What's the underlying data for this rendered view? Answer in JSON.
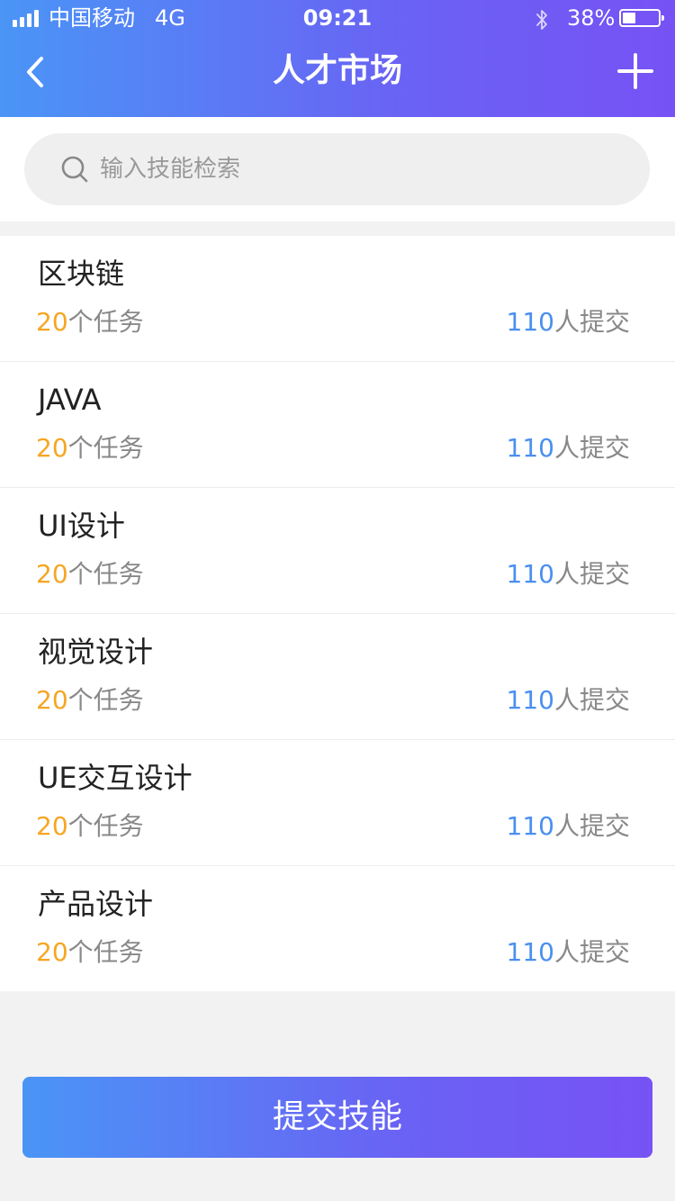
{
  "status_bar": {
    "carrier": "中国移动",
    "network": "4G",
    "time": "09:21",
    "battery_percent": "38%",
    "battery_level": 0.38,
    "icons": [
      "signal-icon",
      "bluetooth-icon",
      "battery-icon"
    ]
  },
  "nav": {
    "title": "人才市场",
    "back_icon": "back-arrow-icon",
    "add_icon": "plus-icon"
  },
  "search": {
    "placeholder": "输入技能检索",
    "value": "",
    "icon": "search-icon"
  },
  "skills": [
    {
      "name": "区块链",
      "task_count": "20",
      "task_suffix": "个任务",
      "submit_count": "110",
      "submit_suffix": "人提交"
    },
    {
      "name": "JAVA",
      "task_count": "20",
      "task_suffix": "个任务",
      "submit_count": "110",
      "submit_suffix": "人提交"
    },
    {
      "name": "UI设计",
      "task_count": "20",
      "task_suffix": "个任务",
      "submit_count": "110",
      "submit_suffix": "人提交"
    },
    {
      "name": "视觉设计",
      "task_count": "20",
      "task_suffix": "个任务",
      "submit_count": "110",
      "submit_suffix": "人提交"
    },
    {
      "name": "UE交互设计",
      "task_count": "20",
      "task_suffix": "个任务",
      "submit_count": "110",
      "submit_suffix": "人提交"
    },
    {
      "name": "产品设计",
      "task_count": "20",
      "task_suffix": "个任务",
      "submit_count": "110",
      "submit_suffix": "人提交"
    }
  ],
  "submit_button": {
    "label": "提交技能"
  },
  "colors": {
    "gradient_start": "#4a95f6",
    "gradient_end": "#7752f5",
    "task_count": "#f5a623",
    "submit_count": "#4a8ff0",
    "page_background": "#f2f2f2"
  }
}
